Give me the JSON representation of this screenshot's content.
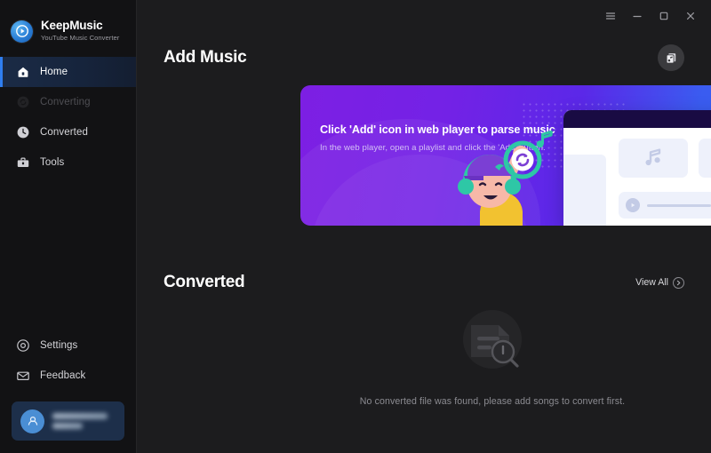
{
  "app": {
    "brand_name": "KeepMusic",
    "brand_tagline": "YouTube Music Converter",
    "logo_icon": "play-circle-icon"
  },
  "titlebar": {
    "menu_icon": "hamburger-menu-icon",
    "minimize_icon": "minimize-icon",
    "maximize_icon": "maximize-icon",
    "close_icon": "close-icon"
  },
  "sidebar": {
    "items": [
      {
        "label": "Home",
        "icon": "home-icon",
        "active": true,
        "disabled": false
      },
      {
        "label": "Converting",
        "icon": "refresh-circle-icon",
        "active": false,
        "disabled": true
      },
      {
        "label": "Converted",
        "icon": "clock-icon",
        "active": false,
        "disabled": false
      },
      {
        "label": "Tools",
        "icon": "toolbox-icon",
        "active": false,
        "disabled": false
      }
    ],
    "bottom_items": [
      {
        "label": "Settings",
        "icon": "gear-circle-icon"
      },
      {
        "label": "Feedback",
        "icon": "envelope-icon"
      }
    ],
    "account": {
      "avatar_icon": "user-avatar-icon",
      "name": "",
      "plan": "",
      "redacted": true
    }
  },
  "main": {
    "add_music": {
      "title": "Add Music",
      "library_button_icon": "music-library-icon"
    },
    "banner": {
      "heading": "Click 'Add' icon in web player to parse music",
      "subtext": "In the web player, open a playlist and click the 'Add' button.",
      "note_icon": "music-note-icon",
      "plus_icon": "plus-icon",
      "cursor_icon": "mouse-cursor-icon",
      "refresh_icon": "refresh-icon",
      "colors": {
        "gradient_start": "#7d1fe3",
        "gradient_mid": "#5b28e8",
        "gradient_end": "#3566ef",
        "accent_teal": "#2ec7a6",
        "accent_pink": "#f06fbe",
        "accent_yellow": "#f2c84b",
        "plus_button": "#2f7ef0"
      }
    },
    "converted": {
      "title": "Converted",
      "view_all_label": "View All",
      "view_all_icon": "chevron-right-icon",
      "empty_icon": "file-search-icon",
      "empty_message": "No converted file was found, please add songs to convert first."
    }
  }
}
